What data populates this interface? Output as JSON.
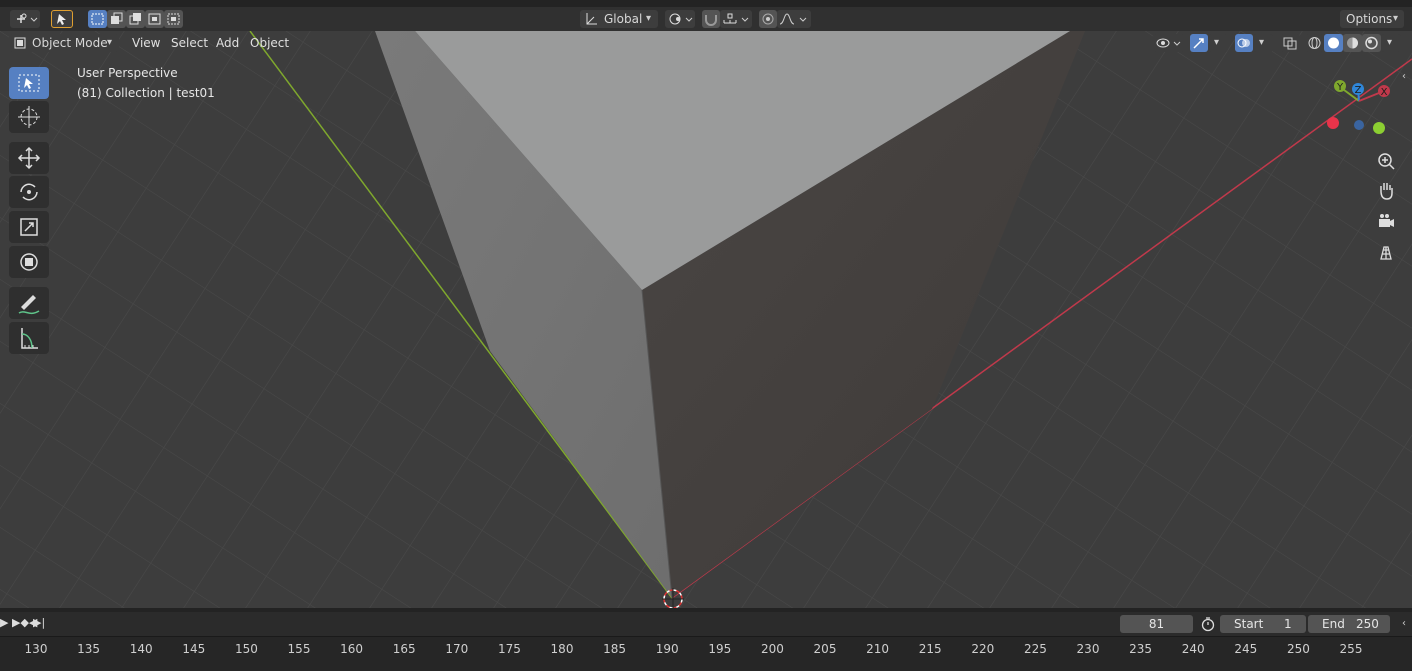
{
  "header": {
    "orientation_label": "Global",
    "options_label": "Options"
  },
  "viewport_header": {
    "mode_label": "Object Mode",
    "menus": [
      "View",
      "Select",
      "Add",
      "Object"
    ]
  },
  "viewport": {
    "perspective_label": "User Perspective",
    "collection_label": "(81) Collection | test01",
    "gizmo": {
      "x_label": "X",
      "y_label": "Y",
      "z_label": "Z"
    }
  },
  "toolbar": {
    "tools": [
      "select-box",
      "cursor",
      "move",
      "rotate",
      "scale",
      "transform",
      "annotate",
      "measure"
    ]
  },
  "timeline": {
    "current_frame": "81",
    "start_label": "Start",
    "start_value": "1",
    "end_label": "End",
    "end_value": "250",
    "ticks": [
      "130",
      "135",
      "140",
      "145",
      "150",
      "155",
      "160",
      "165",
      "170",
      "175",
      "180",
      "185",
      "190",
      "195",
      "200",
      "205",
      "210",
      "215",
      "220",
      "225",
      "230",
      "235",
      "240",
      "245",
      "250",
      "255"
    ]
  },
  "colors": {
    "accent": "#5680c2",
    "x_axis": "#c0394b",
    "y_axis": "#7fa82d",
    "z_axis": "#2f86d8"
  }
}
